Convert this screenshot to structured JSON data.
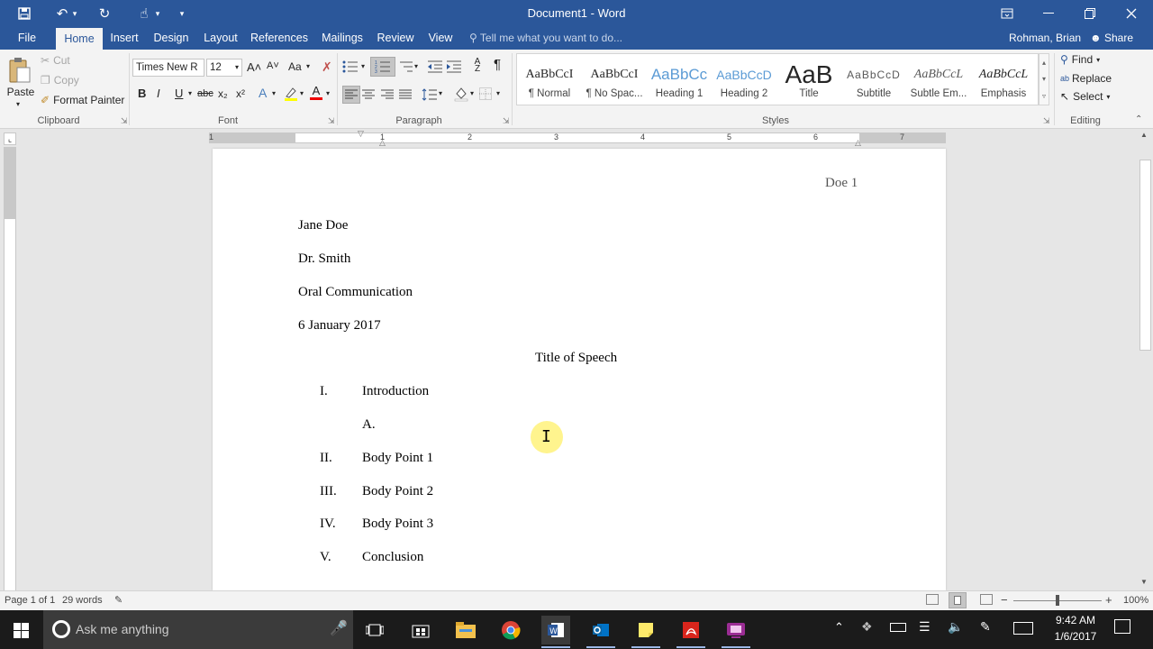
{
  "window": {
    "title": "Document1 - Word",
    "qat_save": "💾",
    "qat_undo": "↶",
    "qat_redo": "↻",
    "qat_touch": "☝",
    "qat_customize": "▾",
    "ribbon_display": "⊞",
    "minimize": "—",
    "restore": "❐",
    "close": "✕"
  },
  "tabs": [
    "File",
    "Home",
    "Insert",
    "Design",
    "Layout",
    "References",
    "Mailings",
    "Review",
    "View"
  ],
  "tell_me": "Tell me what you want to do...",
  "user": "Rohman, Brian",
  "share": "Share",
  "clipboard": {
    "paste": "Paste",
    "cut": "Cut",
    "copy": "Copy",
    "format_painter": "Format Painter",
    "label": "Clipboard"
  },
  "font": {
    "name": "Times New R",
    "size": "12",
    "label": "Font",
    "bold": "B",
    "italic": "I",
    "underline": "U",
    "strike": "abc",
    "sub": "x₂",
    "sup": "x²",
    "grow": "A˄",
    "shrink": "A˅",
    "case": "Aa"
  },
  "paragraph": {
    "label": "Paragraph",
    "pilcrow": "¶"
  },
  "styles": {
    "label": "Styles",
    "items": [
      {
        "sample": "AaBbCcI",
        "name": "¶ Normal"
      },
      {
        "sample": "AaBbCcI",
        "name": "¶ No Spac..."
      },
      {
        "sample": "AaBbCc",
        "name": "Heading 1"
      },
      {
        "sample": "AaBbCcD",
        "name": "Heading 2"
      },
      {
        "sample": "AaB",
        "name": "Title"
      },
      {
        "sample": "AaBbCcD",
        "name": "Subtitle"
      },
      {
        "sample": "AaBbCcL",
        "name": "Subtle Em..."
      },
      {
        "sample": "AaBbCcL",
        "name": "Emphasis"
      }
    ]
  },
  "editing": {
    "find": "Find",
    "replace": "Replace",
    "select": "Select",
    "label": "Editing"
  },
  "ruler_numbers": [
    "1",
    "1",
    "2",
    "3",
    "4",
    "5",
    "6",
    "7"
  ],
  "document": {
    "header": "Doe 1",
    "name": "Jane Doe",
    "instructor": "Dr. Smith",
    "course": "Oral Communication",
    "date": "6 January 2017",
    "title": "Title of Speech",
    "outline": [
      {
        "num": "I.",
        "text": "Introduction"
      },
      {
        "num": "",
        "text": "A."
      },
      {
        "num": "II.",
        "text": "Body Point 1"
      },
      {
        "num": "III.",
        "text": "Body Point 2"
      },
      {
        "num": "IV.",
        "text": "Body Point 3"
      },
      {
        "num": "V.",
        "text": "Conclusion"
      }
    ]
  },
  "status": {
    "page": "Page 1 of 1",
    "words": "29 words",
    "zoom": "100%",
    "zoom_minus": "−",
    "zoom_plus": "+"
  },
  "taskbar": {
    "search_placeholder": "Ask me anything",
    "time": "9:42 AM",
    "date": "1/6/2017"
  },
  "colors": {
    "word_blue": "#2b579a",
    "ribbon_bg": "#f3f3f3",
    "taskbar_bg": "#1b1b1b",
    "cursor_highlight": "#fff27a"
  }
}
